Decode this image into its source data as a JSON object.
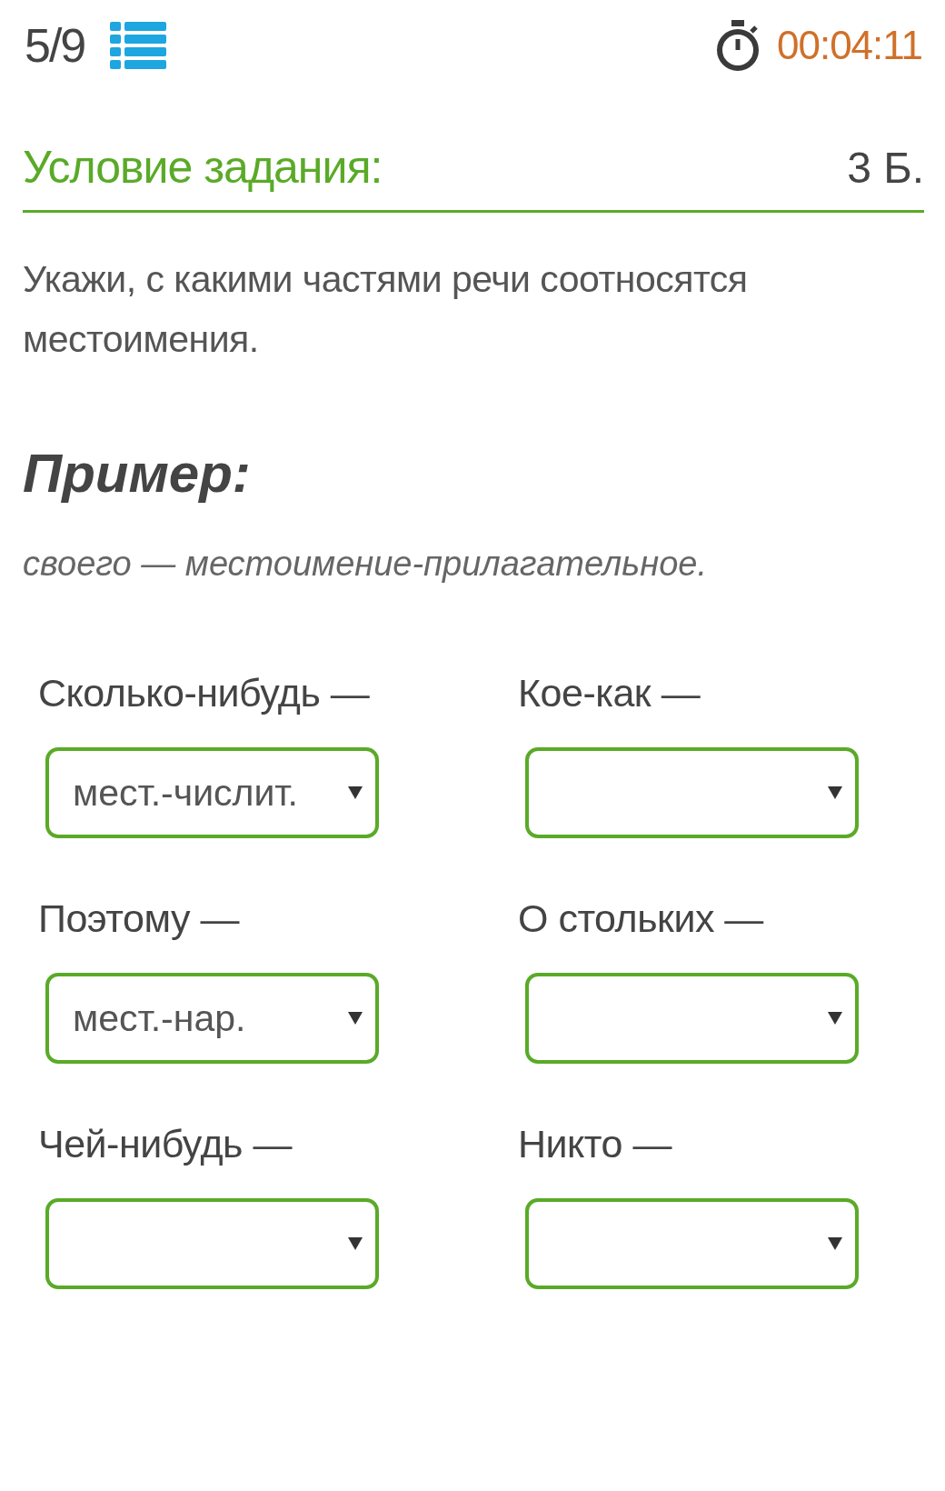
{
  "header": {
    "progress": "5/9",
    "timer": "00:04:11"
  },
  "task": {
    "title": "Условие задания:",
    "points": "3 Б.",
    "instruction": "Укажи, с какими частями речи соотносятся местоимения.",
    "example_heading": "Пример:",
    "example": "своего — местоимение-прилагательное."
  },
  "questions": [
    {
      "word": "Сколько-нибудь —",
      "value": "мест.-числит."
    },
    {
      "word": "Кое-как —"
    },
    {
      "word": "Поэтому —",
      "value": "мест.-нар."
    },
    {
      "word": "О стольких —"
    },
    {
      "word": "Чей-нибудь —"
    },
    {
      "word": "Никто —"
    }
  ]
}
